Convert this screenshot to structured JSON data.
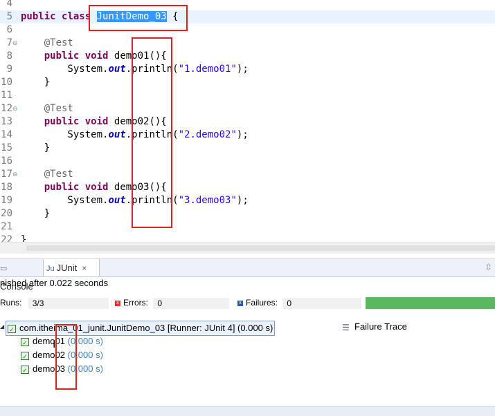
{
  "editor": {
    "lines": [
      {
        "n": "4",
        "fold": "",
        "html": ""
      },
      {
        "n": "5",
        "fold": "",
        "tokens": [
          {
            "t": "public ",
            "c": "kw"
          },
          {
            "t": "class ",
            "c": "kw"
          },
          {
            "t": "JunitDemo_03",
            "c": "sel"
          },
          {
            "t": " {",
            "c": ""
          }
        ]
      },
      {
        "n": "6",
        "fold": "",
        "tokens": []
      },
      {
        "n": "7",
        "fold": "⊖",
        "tokens": [
          {
            "t": "    ",
            "c": ""
          },
          {
            "t": "@Test",
            "c": "ann"
          }
        ]
      },
      {
        "n": "8",
        "fold": "",
        "tokens": [
          {
            "t": "    ",
            "c": ""
          },
          {
            "t": "public ",
            "c": "kw"
          },
          {
            "t": "void ",
            "c": "kw"
          },
          {
            "t": "demo01(){",
            "c": ""
          }
        ]
      },
      {
        "n": "9",
        "fold": "",
        "tokens": [
          {
            "t": "        System.",
            "c": ""
          },
          {
            "t": "out",
            "c": "fld"
          },
          {
            "t": ".println(",
            "c": ""
          },
          {
            "t": "\"1.demo01\"",
            "c": "str"
          },
          {
            "t": ");",
            "c": ""
          }
        ]
      },
      {
        "n": "10",
        "fold": "",
        "tokens": [
          {
            "t": "    }",
            "c": ""
          }
        ]
      },
      {
        "n": "11",
        "fold": "",
        "tokens": []
      },
      {
        "n": "12",
        "fold": "⊖",
        "tokens": [
          {
            "t": "    ",
            "c": ""
          },
          {
            "t": "@Test",
            "c": "ann"
          }
        ]
      },
      {
        "n": "13",
        "fold": "",
        "tokens": [
          {
            "t": "    ",
            "c": ""
          },
          {
            "t": "public ",
            "c": "kw"
          },
          {
            "t": "void ",
            "c": "kw"
          },
          {
            "t": "demo02(){",
            "c": ""
          }
        ]
      },
      {
        "n": "14",
        "fold": "",
        "tokens": [
          {
            "t": "        System.",
            "c": ""
          },
          {
            "t": "out",
            "c": "fld"
          },
          {
            "t": ".println(",
            "c": ""
          },
          {
            "t": "\"2.demo02\"",
            "c": "str"
          },
          {
            "t": ");",
            "c": ""
          }
        ]
      },
      {
        "n": "15",
        "fold": "",
        "tokens": [
          {
            "t": "    }",
            "c": ""
          }
        ]
      },
      {
        "n": "16",
        "fold": "",
        "tokens": []
      },
      {
        "n": "17",
        "fold": "⊖",
        "tokens": [
          {
            "t": "    ",
            "c": ""
          },
          {
            "t": "@Test",
            "c": "ann"
          }
        ]
      },
      {
        "n": "18",
        "fold": "",
        "tokens": [
          {
            "t": "    ",
            "c": ""
          },
          {
            "t": "public ",
            "c": "kw"
          },
          {
            "t": "void ",
            "c": "kw"
          },
          {
            "t": "demo03(){",
            "c": ""
          }
        ]
      },
      {
        "n": "19",
        "fold": "",
        "tokens": [
          {
            "t": "        System.",
            "c": ""
          },
          {
            "t": "out",
            "c": "fld"
          },
          {
            "t": ".println(",
            "c": ""
          },
          {
            "t": "\"3.demo03\"",
            "c": "str"
          },
          {
            "t": ");",
            "c": ""
          }
        ]
      },
      {
        "n": "20",
        "fold": "",
        "tokens": [
          {
            "t": "    }",
            "c": ""
          }
        ]
      },
      {
        "n": "21",
        "fold": "",
        "tokens": []
      },
      {
        "n": "22",
        "fold": "",
        "tokens": [
          {
            "t": "}",
            "c": ""
          }
        ]
      }
    ]
  },
  "tabs": {
    "console": "Console",
    "junit": "JUnit",
    "close": "×"
  },
  "status": "nished after 0.022 seconds",
  "counters": {
    "runs_label": "Runs:",
    "runs_value": "3/3",
    "errors_label": "Errors:",
    "errors_value": "0",
    "failures_label": "Failures:",
    "failures_value": "0",
    "progress": 1.0,
    "progress_color": "#5cb85c"
  },
  "tree": {
    "root": "com.itheima_01_junit.JunitDemo_03 [Runner: JUnit 4] (0.000 s)",
    "items": [
      {
        "name": "demo01",
        "time": "(0.000 s)"
      },
      {
        "name": "demo02",
        "time": "(0.000 s)"
      },
      {
        "name": "demo03",
        "time": "(0.000 s)"
      }
    ]
  },
  "failure_trace": "Failure Trace",
  "colors": {
    "keyword": "#7f0055",
    "string": "#2a00ff",
    "annotation_box": "#e02020"
  }
}
